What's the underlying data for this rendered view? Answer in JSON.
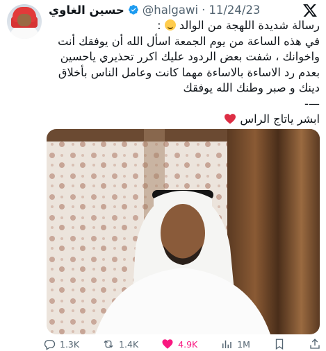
{
  "author": {
    "display_name": "حسين الغاوي",
    "handle": "@halgawi",
    "separator": "·",
    "date": "11/24/23"
  },
  "tweet": {
    "lines": [
      "رسالة شديدة اللهجة من الوالد",
      "في هذه الساعة من يوم الجمعة اسأل الله أن يوفقك أنت",
      "واخوانك ، شفت بعض الردود عليك اكرر تحذيري ياحسين",
      "بعدم رد الاساءة بالاساءة مهما كانت وعامل الناس بأخلاق",
      "دينك و صبر وطنك الله يوفقك",
      "—-",
      "ابشر ياتاج الراس"
    ],
    "emoji_after_line1": "grinning-sweat-emoji",
    "emoji_after_last_line": "red-heart-emoji"
  },
  "stats": {
    "replies": "1.3K",
    "reposts": "1.4K",
    "likes": "4.9K",
    "views": "1M"
  },
  "colors": {
    "text": "#0f1419",
    "secondary": "#536471",
    "verified": "#1d9bf0",
    "like": "#f91880"
  }
}
